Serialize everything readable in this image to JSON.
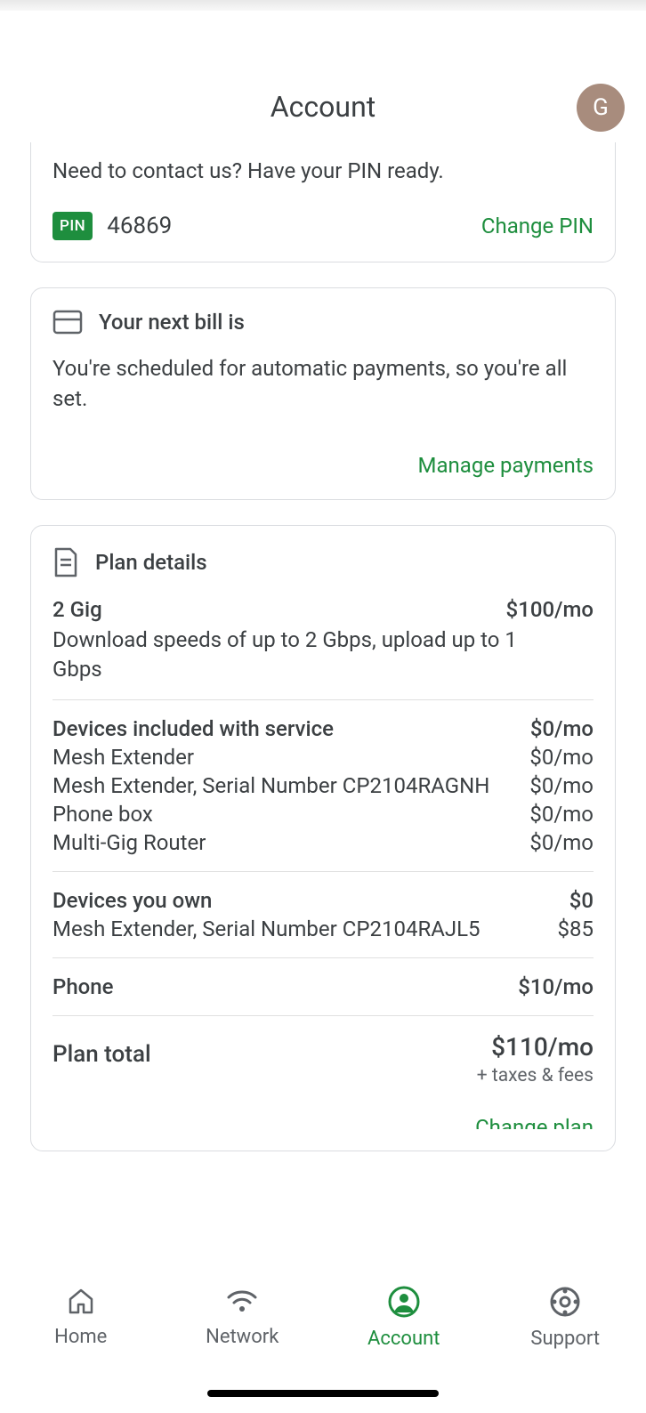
{
  "header": {
    "title": "Account",
    "avatar_letter": "G"
  },
  "pin_card": {
    "contact_text": "Need to contact us? Have your PIN ready.",
    "badge": "PIN",
    "pin_value": "46869",
    "change_label": "Change PIN"
  },
  "bill_card": {
    "title": "Your next bill is",
    "body": "You're scheduled for automatic payments, so you're all set.",
    "action": "Manage payments"
  },
  "plan_card": {
    "title": "Plan details",
    "plan_name": "2 Gig",
    "plan_price": "$100/mo",
    "plan_desc": "Download speeds of up to 2 Gbps, upload up to 1 Gbps",
    "devices_included": {
      "header_label": "Devices included with service",
      "header_price": "$0/mo",
      "items": [
        {
          "label": "Mesh Extender",
          "price": "$0/mo"
        },
        {
          "label": "Mesh Extender, Serial Number CP2104RAGNH",
          "price": "$0/mo"
        },
        {
          "label": "Phone box",
          "price": "$0/mo"
        },
        {
          "label": "Multi-Gig Router",
          "price": "$0/mo"
        }
      ]
    },
    "devices_owned": {
      "header_label": "Devices you own",
      "header_price": "$0",
      "items": [
        {
          "label": "Mesh Extender, Serial Number CP2104RAJL5",
          "price": "$85"
        }
      ]
    },
    "phone": {
      "label": "Phone",
      "price": "$10/mo"
    },
    "total": {
      "label": "Plan total",
      "value": "$110/mo",
      "sub": "+ taxes & fees"
    },
    "change_plan": "Change plan"
  },
  "nav": {
    "home": "Home",
    "network": "Network",
    "account": "Account",
    "support": "Support"
  }
}
